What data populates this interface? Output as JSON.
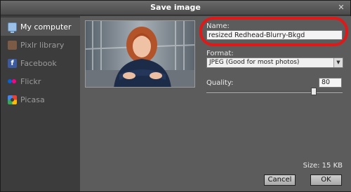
{
  "dialog": {
    "title": "Save image",
    "close_glyph": "✕"
  },
  "sidebar": {
    "items": [
      {
        "label": "My computer",
        "icon": "computer-icon",
        "active": true
      },
      {
        "label": "Pixlr library",
        "icon": "pixlr-library-icon",
        "active": false
      },
      {
        "label": "Facebook",
        "icon": "facebook-icon",
        "active": false
      },
      {
        "label": "Flickr",
        "icon": "flickr-icon",
        "active": false
      },
      {
        "label": "Picasa",
        "icon": "picasa-icon",
        "active": false
      }
    ]
  },
  "form": {
    "name_label": "Name:",
    "name_value": "resized Redhead-Blurry-Bkgd",
    "format_label": "Format:",
    "format_value": "JPEG (Good for most photos)",
    "quality_label": "Quality:",
    "quality_value": "80",
    "quality_level": 0.8,
    "size_text": "Size: 15 KB"
  },
  "buttons": {
    "cancel": "Cancel",
    "ok": "OK"
  },
  "colors": {
    "highlight": "#e01818",
    "active_item_bg": "#545454"
  }
}
